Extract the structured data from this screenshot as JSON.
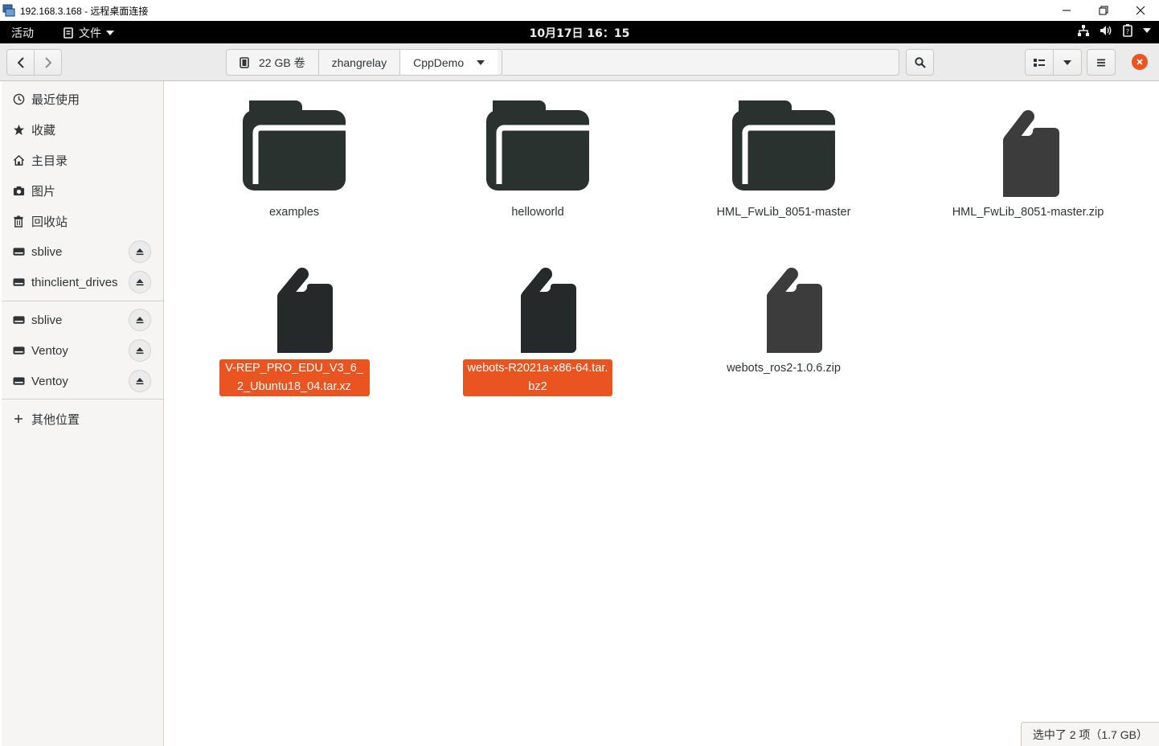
{
  "window": {
    "title": "192.168.3.168 - 远程桌面连接"
  },
  "topbar": {
    "activities": "活动",
    "app_menu": "文件",
    "clock": "10月17日  16：15"
  },
  "header": {
    "pathbar": [
      {
        "label": "22 GB 卷"
      },
      {
        "label": "zhangrelay"
      },
      {
        "label": "CppDemo"
      }
    ]
  },
  "sidebar": {
    "items": [
      {
        "label": "最近使用",
        "icon": "clock-icon"
      },
      {
        "label": "收藏",
        "icon": "star-icon"
      },
      {
        "label": "主目录",
        "icon": "home-icon"
      },
      {
        "label": "图片",
        "icon": "camera-icon"
      },
      {
        "label": "回收站",
        "icon": "trash-icon"
      },
      {
        "label": "sblive",
        "icon": "drive-icon"
      },
      {
        "label": "thinclient_drives",
        "icon": "drive-icon"
      },
      {
        "label": "sblive",
        "icon": "drive-icon"
      },
      {
        "label": "Ventoy",
        "icon": "drive-icon"
      },
      {
        "label": "Ventoy",
        "icon": "drive-icon"
      },
      {
        "label": "其他位置",
        "icon": "plus-icon"
      }
    ]
  },
  "files": [
    {
      "name": "examples",
      "type": "folder",
      "selected": false
    },
    {
      "name": "helloworld",
      "type": "folder",
      "selected": false
    },
    {
      "name": "HML_FwLib_8051-master",
      "type": "folder",
      "selected": false
    },
    {
      "name": "HML_FwLib_8051-master.zip",
      "type": "archive",
      "selected": false
    },
    {
      "name": "V-REP_PRO_EDU_V3_6_2_Ubuntu18_04.tar.xz",
      "type": "archive",
      "selected": true
    },
    {
      "name": "webots-R2021a-x86-64.tar.bz2",
      "type": "archive",
      "selected": true
    },
    {
      "name": "webots_ros2-1.0.6.zip",
      "type": "archive",
      "selected": false
    }
  ],
  "status": {
    "text": "选中了 2 项（1.7 GB）"
  },
  "colors": {
    "accent": "#e95420",
    "folder": "#2a3230",
    "archive": "#3c3c3c",
    "close_button": "#e95420"
  }
}
